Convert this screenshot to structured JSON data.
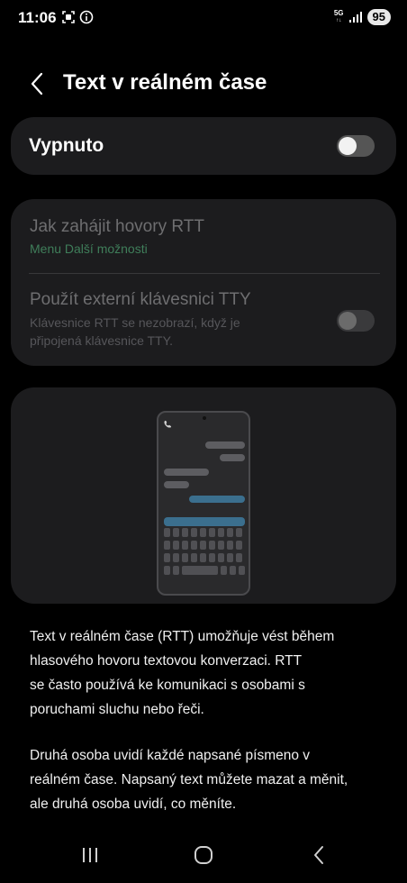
{
  "status_bar": {
    "time": "11:06",
    "network": "5G",
    "battery": "95"
  },
  "header": {
    "title": "Text v reálném čase"
  },
  "main_toggle": {
    "label": "Vypnuto",
    "state": "off"
  },
  "options": [
    {
      "title": "Jak zahájit hovory RTT",
      "subtitle": "Menu Další možnosti"
    },
    {
      "title": "Použít externí klávesnici TTY",
      "subtitle_line1": "Klávesnice RTT se nezobrazí, když je",
      "subtitle_line2": "připojená klávesnice TTY.",
      "state": "off"
    }
  ],
  "description": {
    "p1_l1": "Text v reálném čase (RTT) umožňuje vést během",
    "p1_l2": "hlasového hovoru textovou konverzaci. RTT",
    "p1_l3": "se často používá ke komunikaci s osobami s",
    "p1_l4": "poruchami sluchu nebo řeči.",
    "p2_l1": "Druhá osoba uvidí každé napsané písmeno v",
    "p2_l2": "reálném čase. Napsaný text můžete mazat a měnit,",
    "p2_l3": "ale druhá osoba uvidí, co měníte."
  },
  "colors": {
    "background": "#000000",
    "card": "#1c1c1e",
    "accent_green": "#3f7e5a",
    "disabled_text": "#6e6e70"
  }
}
